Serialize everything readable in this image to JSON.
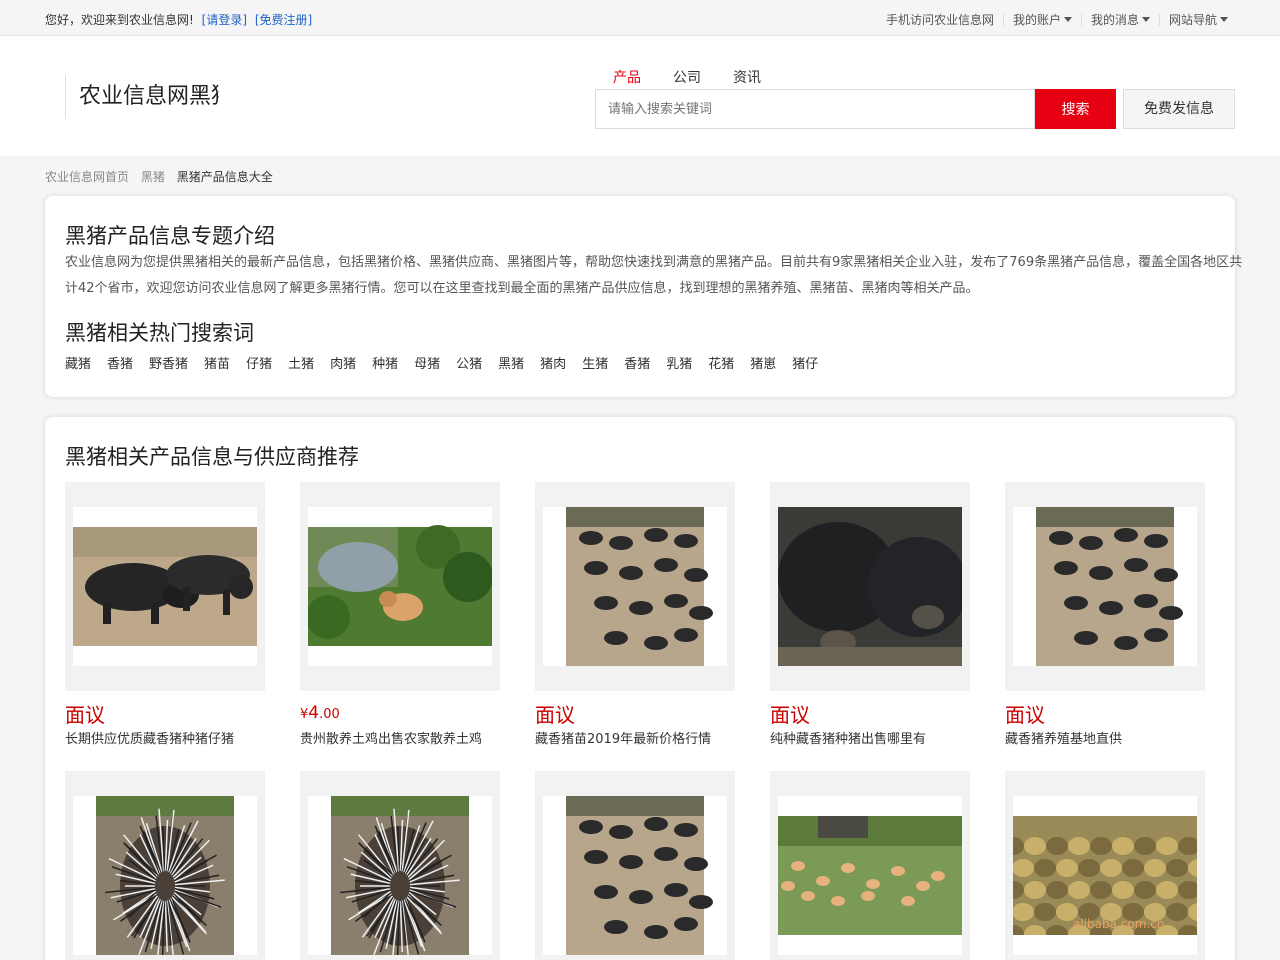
{
  "topbar": {
    "welcome": "您好，欢迎来到农业信息网!",
    "login": "[请登录]",
    "register": "[免费注册]",
    "links": [
      "手机访问农业信息网",
      "我的账户",
      "我的消息",
      "网站导航"
    ]
  },
  "header": {
    "logo_text": "农业信息网黑猪频道",
    "search_tabs": [
      "产品",
      "公司",
      "资讯"
    ],
    "search_placeholder": "请输入搜索关键词",
    "search_button": "搜索",
    "publish_button": "免费发信息"
  },
  "breadcrumb": [
    "农业信息网首页",
    "黑猪",
    "黑猪产品信息大全"
  ],
  "intro": {
    "heading": "黑猪产品信息专题介绍",
    "text": "农业信息网为您提供黑猪相关的最新产品信息，包括黑猪价格、黑猪供应商、黑猪图片等，帮助您快速找到满意的黑猪产品。目前共有9家黑猪相关企业入驻，发布了769条黑猪产品信息，覆盖全国各地区共计42个省市，欢迎您访问农业信息网了解更多黑猪行情。您可以在这里查找到最全面的黑猪产品供应信息，找到理想的黑猪养殖、黑猪苗、黑猪肉等相关产品。",
    "tags_heading": "黑猪相关热门搜索词",
    "tags": [
      "藏猪",
      "香猪",
      "野香猪",
      "猪苗",
      "仔猪",
      "土猪",
      "肉猪",
      "种猪",
      "母猪",
      "公猪",
      "黑猪",
      "猪肉",
      "生猪",
      "香猪",
      "乳猪",
      "花猪",
      "猪崽",
      "猪仔"
    ]
  },
  "products": {
    "heading": "黑猪相关产品信息与供应商推荐",
    "items": [
      {
        "price": "面议",
        "title": "长期供应优质藏香猪种猪仔猪",
        "photo": "pig-pair"
      },
      {
        "price_symbol": "¥",
        "price": "4",
        "price_cents": ".00",
        "title": "贵州散养土鸡出售农家散养土鸡",
        "photo": "chicken"
      },
      {
        "price": "面议",
        "title": "藏香猪苗2019年最新价格行情",
        "photo": "pig-herd"
      },
      {
        "price": "面议",
        "title": "纯种藏香猪种猪出售哪里有",
        "photo": "pig-close"
      },
      {
        "price": "面议",
        "title": "藏香猪养殖基地直供",
        "photo": "pig-herd2"
      },
      {
        "price": "",
        "title": "",
        "photo": "porcupine"
      },
      {
        "price": "",
        "title": "",
        "photo": "porcupine"
      },
      {
        "price": "",
        "title": "",
        "photo": "pig-herd"
      },
      {
        "price": "",
        "title": "",
        "photo": "chicken-field"
      },
      {
        "price": "",
        "title": "",
        "photo": "ducklings"
      }
    ]
  },
  "watermark": "alibaba.com.cn"
}
